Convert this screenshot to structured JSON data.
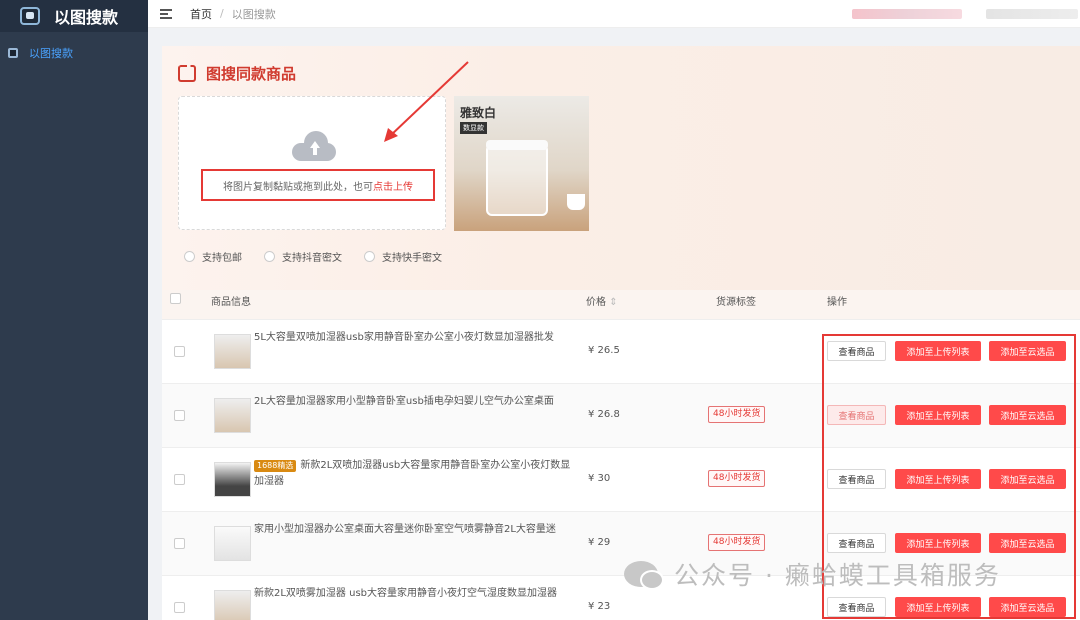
{
  "app": {
    "title": "以图搜款"
  },
  "sidebar": {
    "items": [
      {
        "label": "以图搜款",
        "icon": "image-search-icon"
      }
    ]
  },
  "breadcrumb": {
    "home": "首页",
    "sep": "/",
    "current": "以图搜款"
  },
  "search": {
    "title": "图搜同款商品",
    "upload_text": "将图片复制黏贴或拖到此处，也可",
    "upload_link": "点击上传",
    "preview": {
      "title": "雅致白",
      "badge": "数显款"
    },
    "options": [
      "支持包邮",
      "支持抖音密文",
      "支持快手密文"
    ]
  },
  "table": {
    "headers": {
      "info": "商品信息",
      "price": "价格",
      "tag": "货源标签",
      "action": "操作"
    },
    "buttons": {
      "view": "查看商品",
      "upload": "添加至上传列表",
      "cloud": "添加至云选品"
    },
    "rows": [
      {
        "title": "5L大容量双喷加湿器usb家用静音卧室办公室小夜灯数显加湿器批发",
        "price": "¥ 26.5",
        "tag": ""
      },
      {
        "title": "2L大容量加湿器家用小型静音卧室usb插电孕妇婴儿空气办公室桌面",
        "price": "¥ 26.8",
        "tag": "48小时发货"
      },
      {
        "title": "新款2L双喷加湿器usb大容量家用静音卧室办公室小夜灯数显加湿器",
        "badge": "1688精选",
        "price": "¥ 30",
        "tag": "48小时发货"
      },
      {
        "title": "家用小型加湿器办公室桌面大容量迷你卧室空气喷雾静音2L大容量迷",
        "price": "¥ 29",
        "tag": "48小时发货"
      },
      {
        "title": "新款2L双喷雾加湿器 usb大容量家用静音小夜灯空气湿度数显加湿器",
        "price": "¥ 23",
        "tag": ""
      }
    ]
  },
  "watermark": {
    "text": "公众号 · 癞蛤蟆工具箱服务"
  },
  "colors": {
    "accent": "#ff4a4a",
    "sidebar": "#2e3b4d",
    "link": "#4aa3ff"
  }
}
